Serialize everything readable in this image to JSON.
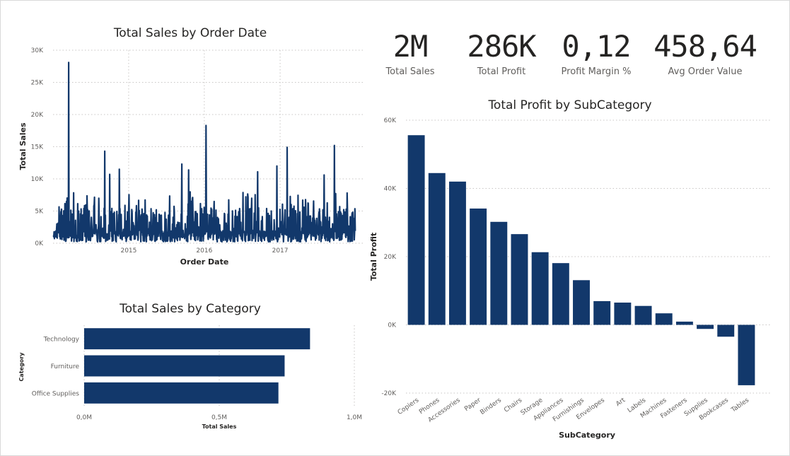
{
  "kpis": [
    {
      "value": "2M",
      "label": "Total Sales"
    },
    {
      "value": "286K",
      "label": "Total Profit"
    },
    {
      "value": "0,12",
      "label": "Profit Margin %"
    },
    {
      "value": "458,64",
      "label": "Avg Order Value"
    }
  ],
  "colors": {
    "bar": "#12386b",
    "grid": "#c8c6c4",
    "text": "#252423",
    "axis": "#605e5c"
  },
  "chart_data": [
    {
      "type": "line",
      "title": "Total Sales by Order Date",
      "xlabel": "Order Date",
      "ylabel": "Total Sales",
      "xlim": [
        "2014-01-01",
        "2018-01-01"
      ],
      "ylim": [
        0,
        30000
      ],
      "yticks": [
        0,
        5000,
        10000,
        15000,
        20000,
        25000,
        30000
      ],
      "ytick_labels": [
        "0K",
        "5K",
        "10K",
        "15K",
        "20K",
        "25K",
        "30K"
      ],
      "xticks": [
        "2015",
        "2016",
        "2017"
      ],
      "peaks": [
        {
          "x": "2014-03-18",
          "y": 28100
        },
        {
          "x": "2014-09-08",
          "y": 14300
        },
        {
          "x": "2014-10-02",
          "y": 10700
        },
        {
          "x": "2014-11-17",
          "y": 11500
        },
        {
          "x": "2015-09-15",
          "y": 12300
        },
        {
          "x": "2015-10-18",
          "y": 11400
        },
        {
          "x": "2016-01-09",
          "y": 18300
        },
        {
          "x": "2016-09-15",
          "y": 11100
        },
        {
          "x": "2016-12-16",
          "y": 12000
        },
        {
          "x": "2017-02-04",
          "y": 14900
        },
        {
          "x": "2017-08-01",
          "y": 10600
        },
        {
          "x": "2017-09-20",
          "y": 15200
        },
        {
          "x": "2017-11-20",
          "y": 7800
        }
      ],
      "grid": true
    },
    {
      "type": "bar",
      "orientation": "horizontal",
      "title": "Total Sales by Category",
      "xlabel": "Total Sales",
      "ylabel": "Category",
      "categories": [
        "Technology",
        "Furniture",
        "Office Supplies"
      ],
      "values": [
        836000,
        742000,
        719000
      ],
      "xlim": [
        0,
        1000000
      ],
      "xtick_labels": [
        "0,0M",
        "0,5M",
        "1,0M"
      ],
      "grid": true
    },
    {
      "type": "bar",
      "title": "Total Profit by SubCategory",
      "xlabel": "SubCategory",
      "ylabel": "Total Profit",
      "categories": [
        "Copiers",
        "Phones",
        "Accessories",
        "Paper",
        "Binders",
        "Chairs",
        "Storage",
        "Appliances",
        "Furnishings",
        "Envelopes",
        "Art",
        "Labels",
        "Machines",
        "Fasteners",
        "Supplies",
        "Bookcases",
        "Tables"
      ],
      "values": [
        55600,
        44500,
        42000,
        34100,
        30200,
        26600,
        21300,
        18100,
        13100,
        6960,
        6530,
        5550,
        3380,
        950,
        -1190,
        -3470,
        -17700
      ],
      "ylim": [
        -20000,
        60000
      ],
      "yticks": [
        -20000,
        0,
        20000,
        40000,
        60000
      ],
      "ytick_labels": [
        "-20K",
        "0K",
        "20K",
        "40K",
        "60K"
      ],
      "grid": true
    }
  ]
}
